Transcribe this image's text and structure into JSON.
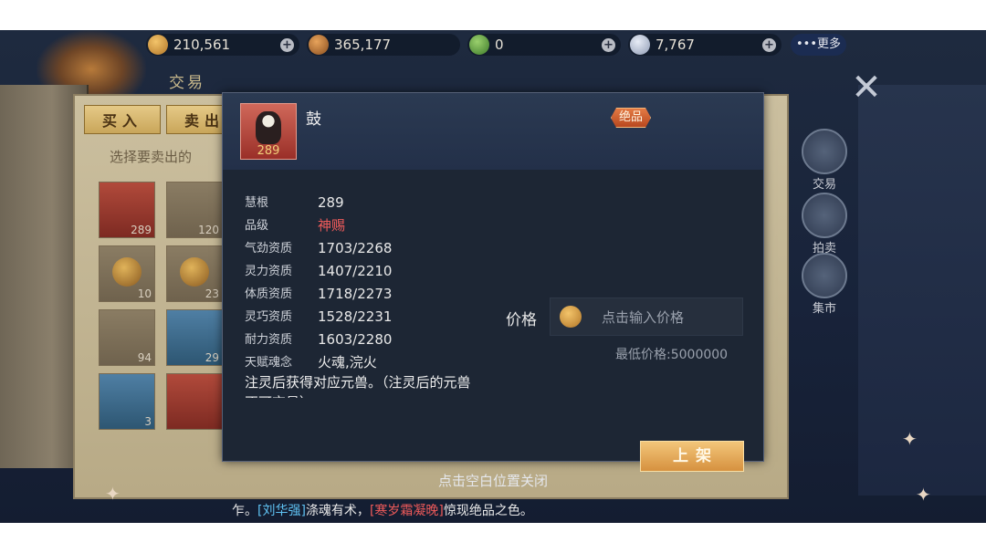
{
  "resources": [
    {
      "icon": "gold-ingot-icon",
      "value": "210,561"
    },
    {
      "icon": "treasure-bag-icon",
      "value": "365,177"
    },
    {
      "icon": "jade-token-icon",
      "value": "0"
    },
    {
      "icon": "crystal-icon",
      "value": "7,767"
    }
  ],
  "more_label": "•••更多",
  "background": {
    "title": "交易",
    "tabs": [
      "买入",
      "卖出"
    ],
    "hint": "选择要卖出的",
    "grid_quantities": [
      "289",
      "120",
      "10",
      "23",
      "94",
      "29",
      "3",
      ""
    ],
    "side_buttons": [
      "交易",
      "拍卖",
      "集市"
    ]
  },
  "item": {
    "name": "鼓",
    "level": "289",
    "rarity": "绝品",
    "attributes": [
      {
        "label": "慧根",
        "value": "289"
      },
      {
        "label": "品级",
        "value": "神赐"
      },
      {
        "label": "气劲资质",
        "value": "1703/2268"
      },
      {
        "label": "灵力资质",
        "value": "1407/2210"
      },
      {
        "label": "体质资质",
        "value": "1718/2273"
      },
      {
        "label": "灵巧资质",
        "value": "1528/2231"
      },
      {
        "label": "耐力资质",
        "value": "1603/2280"
      },
      {
        "label": "天赋魂念",
        "value": "火魂,浣火"
      }
    ],
    "description": "注灵后获得对应元兽。（注灵后的元兽不可交易）"
  },
  "price": {
    "label": "价格",
    "placeholder": "点击输入价格",
    "min_price": "最低价格:5000000"
  },
  "list_button": "上架",
  "close_hint": "点击空白位置关闭",
  "ticker": {
    "prefix": "乍。",
    "name1": "[刘华强]",
    "text1": "涤魂有术，",
    "name2": "[寒岁霜凝晚]",
    "text2": "惊现绝品之色。"
  },
  "colors": {
    "rarity_bg": "#d0602f",
    "grade_red": "#ef5b5b",
    "ticker_blue": "#5fc2f3",
    "ticker_red": "#ee5a5a",
    "button_gold": "#e3a552"
  }
}
